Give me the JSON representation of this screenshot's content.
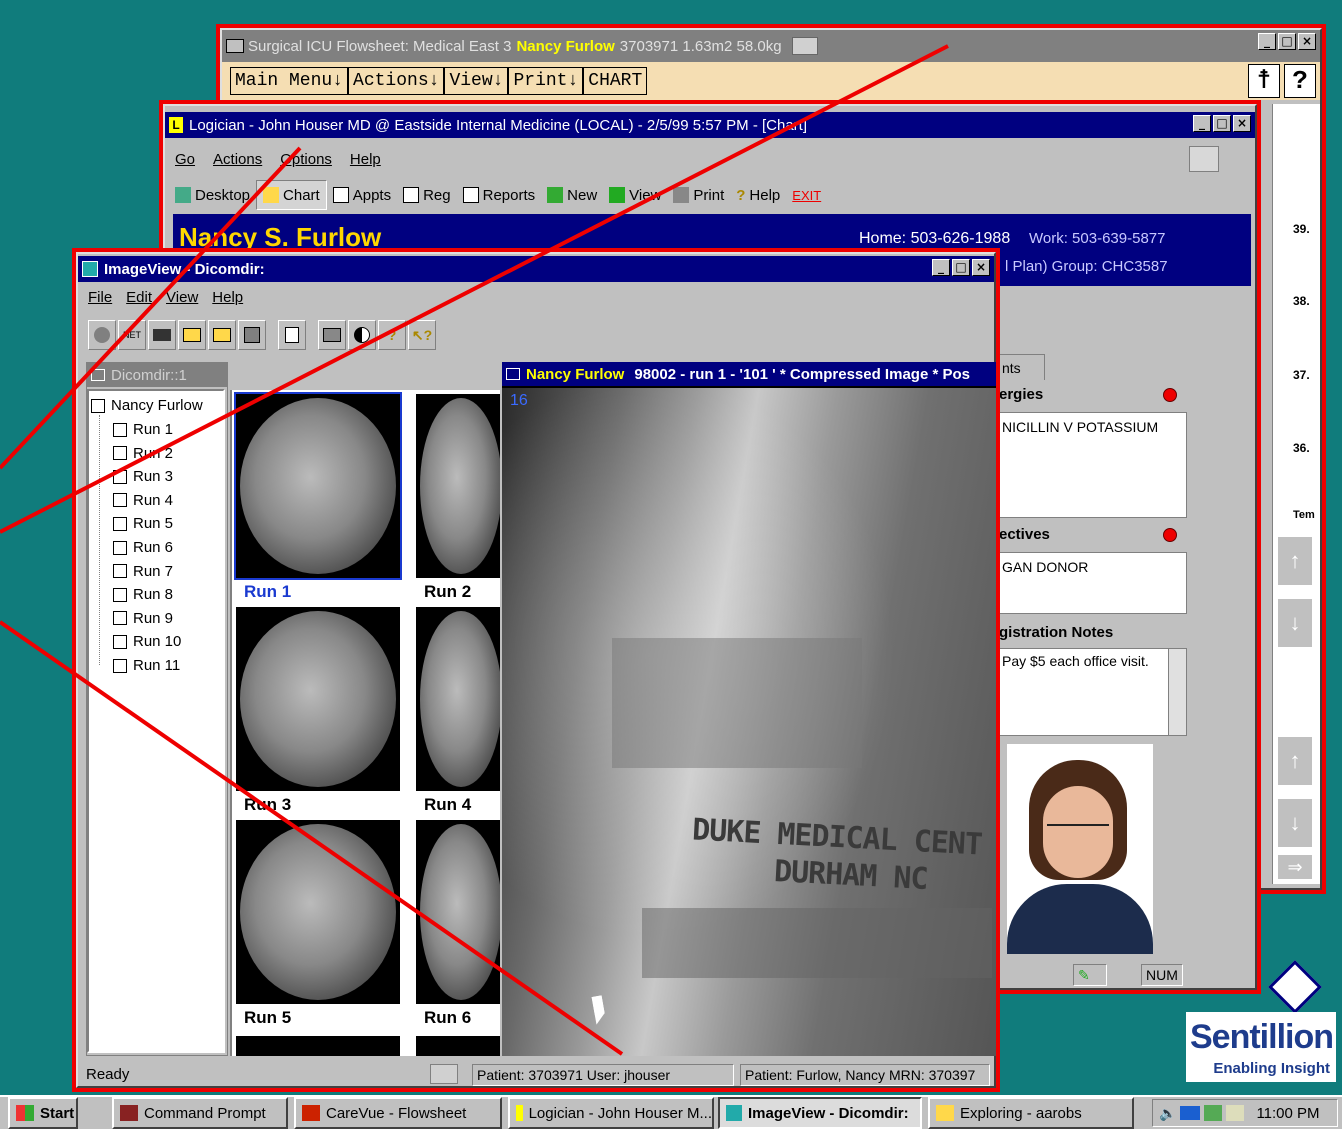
{
  "flowsheet": {
    "title_prefix": "Surgical ICU Flowsheet: Medical East 3",
    "title_patient": "Nancy Furlow",
    "title_suffix": "3703971 1.63m2 58.0kg",
    "menu": [
      "Main Menu↓",
      "Actions↓",
      "View↓",
      "Print↓",
      "CHART"
    ],
    "axis_labels": [
      "39.",
      "38.",
      "37.",
      "36.",
      "Tem"
    ]
  },
  "logician": {
    "title": "Logician  -  John Houser MD @ Eastside Internal Medicine (LOCAL)  -  2/5/99  5:57 PM - [Chart]",
    "menu": [
      "Go",
      "Actions",
      "Options",
      "Help"
    ],
    "toolbar": [
      "Desktop",
      "Chart",
      "Appts",
      "Reg",
      "Reports",
      "New",
      "View",
      "Print",
      "Help",
      "EXIT"
    ],
    "patient_name": "Nancy S. Furlow",
    "home_phone": "Home: 503-626-1988",
    "work_phone": "Work: 503-639-5877",
    "plan_line": "l Plan)  Group: CHC3587",
    "tab_partial": "nts",
    "allergies_header": "ergies",
    "allergies_text": "NICILLIN V POTASSIUM",
    "directives_header": "ectives",
    "directives_text": "GAN DONOR",
    "registration_header": "gistration Notes",
    "registration_text": "Pay $5 each office visit.",
    "status_num": "NUM",
    "indicator_color": "#e00000"
  },
  "imageview": {
    "title": "ImageView - Dicomdir:",
    "menu": [
      "File",
      "Edit",
      "View",
      "Help"
    ],
    "tree_title": "Dicomdir::1",
    "tree_root": "Nancy Furlow",
    "runs": [
      "Run 1",
      "Run 2",
      "Run 3",
      "Run 4",
      "Run 5",
      "Run 6",
      "Run 7",
      "Run 8",
      "Run 9",
      "Run 10",
      "Run 11"
    ],
    "thumb_labels": [
      "Run 1",
      "Run 2",
      "Run 3",
      "Run 4",
      "Run 5",
      "Run 6"
    ],
    "viewer_title_patient": "Nancy Furlow",
    "viewer_title_rest": "98002 - run 1 - '101 ' * Compressed Image * Pos",
    "frame_number": "16",
    "watermark_line1": "DUKE MEDICAL CENT",
    "watermark_line2": "DURHAM NC",
    "status_ready": "Ready",
    "status_patient_user": "Patient: 3703971  User: jhouser",
    "status_patient_mrn": "Patient: Furlow, Nancy MRN: 370397"
  },
  "taskbar": {
    "start": "Start",
    "items": [
      "Command Prompt",
      "CareVue - Flowsheet",
      "Logician  - John Houser M...",
      "ImageView - Dicomdir:",
      "Exploring - aarobs"
    ],
    "clock": "11:00 PM"
  },
  "logo": {
    "name": "Sentillion",
    "tagline": "Enabling Insight"
  }
}
